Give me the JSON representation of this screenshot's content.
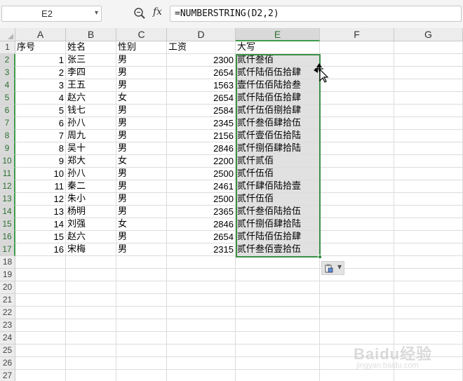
{
  "formula_bar": {
    "name_box": "E2",
    "fx_label": "fx",
    "formula": "=NUMBERSTRING(D2,2)"
  },
  "columns": [
    "A",
    "B",
    "C",
    "D",
    "E",
    "F",
    "G"
  ],
  "selected_column": "E",
  "row_numbers": [
    "1",
    "2",
    "3",
    "4",
    "5",
    "6",
    "7",
    "8",
    "9",
    "10",
    "11",
    "12",
    "13",
    "14",
    "15",
    "16",
    "17",
    "18",
    "19",
    "20",
    "21",
    "22",
    "23",
    "24",
    "25",
    "26",
    "27"
  ],
  "header_row": [
    "序号",
    "姓名",
    "性别",
    "工资",
    "大写"
  ],
  "rows": [
    [
      "1",
      "张三",
      "男",
      "2300",
      "贰仟叁佰"
    ],
    [
      "2",
      "李四",
      "男",
      "2654",
      "贰仟陆佰伍拾肆"
    ],
    [
      "3",
      "王五",
      "男",
      "1563",
      "壹仟伍佰陆拾叁"
    ],
    [
      "4",
      "赵六",
      "女",
      "2654",
      "贰仟陆佰伍拾肆"
    ],
    [
      "5",
      "钱七",
      "男",
      "2584",
      "贰仟伍佰捌拾肆"
    ],
    [
      "6",
      "孙八",
      "男",
      "2345",
      "贰仟叁佰肆拾伍"
    ],
    [
      "7",
      "周九",
      "男",
      "2156",
      "贰仟壹佰伍拾陆"
    ],
    [
      "8",
      "吴十",
      "男",
      "2846",
      "贰仟捌佰肆拾陆"
    ],
    [
      "9",
      "郑大",
      "女",
      "2200",
      "贰仟贰佰"
    ],
    [
      "10",
      "孙八",
      "男",
      "2500",
      "贰仟伍佰"
    ],
    [
      "11",
      "秦二",
      "男",
      "2461",
      "贰仟肆佰陆拾壹"
    ],
    [
      "12",
      "朱小",
      "男",
      "2500",
      "贰仟伍佰"
    ],
    [
      "13",
      "杨明",
      "男",
      "2365",
      "贰仟叁佰陆拾伍"
    ],
    [
      "14",
      "刘强",
      "女",
      "2846",
      "贰仟捌佰肆拾陆"
    ],
    [
      "15",
      "赵六",
      "男",
      "2654",
      "贰仟陆佰伍拾肆"
    ],
    [
      "16",
      "宋梅",
      "男",
      "2315",
      "贰仟叁佰壹拾伍"
    ]
  ],
  "icons": {
    "zoom": "zoom-icon",
    "paste_options": "paste-options-icon",
    "cursor": "move-cursor-icon"
  },
  "colors": {
    "selection_border": "#3c8f46",
    "selection_fill": "#e1e1e1"
  },
  "watermark": {
    "brand": "Baidu经验",
    "url": "jingyan.baidu.com"
  }
}
